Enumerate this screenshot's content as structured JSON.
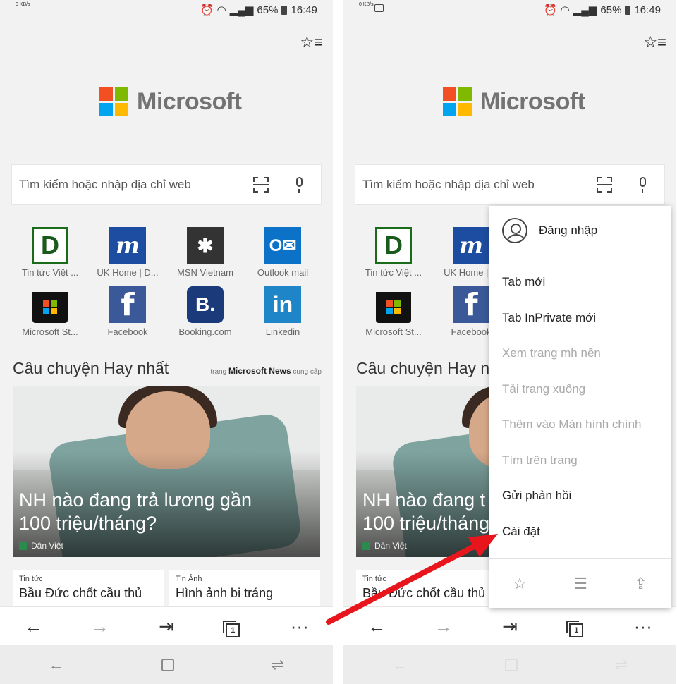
{
  "status": {
    "speed": "0 KB/s",
    "battery": "65%",
    "time": "16:49"
  },
  "brand": {
    "name": "Microsoft",
    "colors": [
      "#f25022",
      "#7fba00",
      "#00a4ef",
      "#ffb900"
    ]
  },
  "search": {
    "placeholder": "Tìm kiếm hoặc nhập địa chỉ web"
  },
  "tiles": [
    {
      "glyph": "D",
      "label": "Tin tức Việt ..."
    },
    {
      "glyph": "m",
      "label": "UK Home | D..."
    },
    {
      "glyph": "✱",
      "label": "MSN Vietnam"
    },
    {
      "glyph": "O✉",
      "label": "Outlook mail"
    },
    {
      "glyph": "",
      "label": "Microsoft St..."
    },
    {
      "glyph": "f",
      "label": "Facebook"
    },
    {
      "glyph": "B.",
      "label": "Booking.com"
    },
    {
      "glyph": "in",
      "label": "Linkedin"
    }
  ],
  "tiles_right": [
    {
      "label": "Tin tức Việt ..."
    },
    {
      "label": "UK Home | ..."
    },
    {
      "label": "Microsoft St..."
    },
    {
      "label": "Facebook"
    }
  ],
  "stories": {
    "heading": "Câu chuyện Hay nhất",
    "heading_right": "Câu chuyện Hay n",
    "by_prefix": "trang",
    "by_source": "Microsoft News",
    "by_suffix": "cung cấp"
  },
  "hero": {
    "title_l1": "NH nào đang trả lương gần",
    "title_l2": "100 triệu/tháng?",
    "title_r1": "NH nào đang t",
    "title_r2": "100 triệu/tháng",
    "source": "Dân Việt"
  },
  "cards": [
    {
      "kicker": "Tin tức",
      "title": "Bầu Đức chốt cầu thủ"
    },
    {
      "kicker": "Tin Ảnh",
      "title": "Hình ảnh bi tráng"
    }
  ],
  "card_right": {
    "kicker": "Tin tức",
    "title": "Bầu Đức chốt cầu thủ"
  },
  "toolbar": {
    "back": "←",
    "forward": "→",
    "share": "⇥",
    "tabs_count": "1",
    "more": "···"
  },
  "navbar": {
    "back": "←",
    "switch": "⇌"
  },
  "menu": {
    "signin": "Đăng nhập",
    "items": [
      {
        "label": "Tab mới",
        "enabled": true
      },
      {
        "label": "Tab InPrivate mới",
        "enabled": true
      },
      {
        "label": "Xem trang mh nền",
        "enabled": false
      },
      {
        "label": "Tải trang xuống",
        "enabled": false
      },
      {
        "label": "Thêm vào Màn hình chính",
        "enabled": false
      },
      {
        "label": "Tìm trên trang",
        "enabled": false
      },
      {
        "label": "Gửi phản hồi",
        "enabled": true
      },
      {
        "label": "Cài đặt",
        "enabled": true
      }
    ],
    "bottom_icons": [
      "star-icon",
      "reading-list-icon",
      "share-icon"
    ]
  },
  "annotation": {
    "arrow_color": "#e8161c"
  }
}
